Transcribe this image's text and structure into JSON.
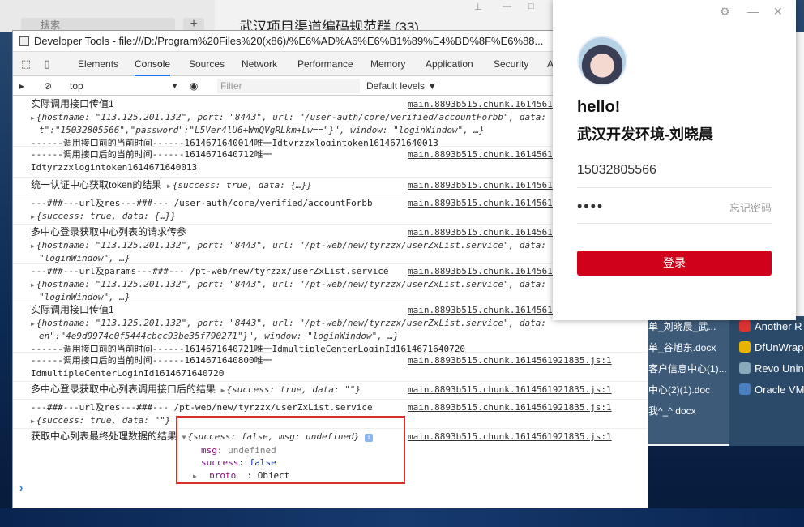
{
  "chat": {
    "search": "搜索",
    "title": "武汉项目渠道编码规范群 (33)"
  },
  "devtools": {
    "title": "Developer Tools - file:///D:/Program%20Files%20(x86)/%E6%AD%A6%E6%B1%89%E4%BD%8F%E6%88...",
    "tabs": [
      "Elements",
      "Console",
      "Sources",
      "Network",
      "Performance",
      "Memory",
      "Application",
      "Security",
      "A"
    ],
    "context": "top",
    "filter_placeholder": "Filter",
    "levels": "Default levels ▼",
    "source": "main.8893b515.chunk.1614561921835.js:1"
  },
  "console": [
    {
      "text": "实际调用接口传值1",
      "obj": "{hostname: \"113.125.201.132\", port: \"8443\", url: \"/user-auth/core/verified/accountForbb\", data:",
      "obj2": "t\":\"15032805566\",\"password\":\"L5Ver4lU6+WmQVgRLkm+Lw==\"}\", window: \"loginWindow\", …}",
      "line3": "------调用接口前的当前时间------1614671640014唯一Idtyrzzxlogintoken1614671640013"
    },
    {
      "text": "------调用接口后的当前时间------1614671640712唯一",
      "line2": "Idtyrzzxlogintoken1614671640013"
    },
    {
      "text": "统一认证中心获取token的结果",
      "obj": "{success: true, data: {…}}"
    },
    {
      "text": "---###---url及res---###--- /user-auth/core/verified/accountForbb",
      "obj": "{success: true, data: {…}}"
    },
    {
      "text": "多中心登录获取中心列表的请求传参",
      "obj": "{hostname: \"113.125.201.132\", port: \"8443\", url: \"/pt-web/new/tyrzzx/userZxList.service\", data:",
      "obj2": "\"loginWindow\", …}"
    },
    {
      "text": "---###---url及params---###--- /pt-web/new/tyrzzx/userZxList.service",
      "obj": "{hostname: \"113.125.201.132\", port: \"8443\", url: \"/pt-web/new/tyrzzx/userZxList.service\", data:",
      "obj2": "\"loginWindow\", …}"
    },
    {
      "text": "实际调用接口传值1",
      "obj": "{hostname: \"113.125.201.132\", port: \"8443\", url: \"/pt-web/new/tyrzzx/userZxList.service\", data:",
      "obj2": "en\":\"4e9d9974c0f5444cbcc93be35f790271\"}\", window: \"loginWindow\", …}",
      "line3": "------调用接口前的当前时间------1614671640721唯一IdmultipleCenterLoginId1614671640720"
    },
    {
      "text": "------调用接口后的当前时间------1614671640800唯一",
      "line2": "IdmultipleCenterLoginId1614671640720"
    },
    {
      "text": "多中心登录获取中心列表调用接口后的结果",
      "obj": "{success: true, data: \"\"}"
    },
    {
      "text": "---###---url及res---###--- /pt-web/new/tyrzzx/userZxList.service",
      "obj": "{success: true, data: \"\"}"
    },
    {
      "text": "获取中心列表最终处理数据的结果",
      "obj": "{success: false, msg: undefined}",
      "props": [
        {
          "k": "msg",
          "v": "undefined"
        },
        {
          "k": "success",
          "v": "false"
        },
        {
          "k": "__proto__",
          "v": "Object"
        }
      ]
    }
  ],
  "login": {
    "hello": "hello!",
    "env": "武汉开发环境-刘晓晨",
    "phone": "15032805566",
    "password": "••••",
    "forgot": "忘记密码",
    "submit": "登录"
  },
  "files": [
    "单_刘晓晨_武...",
    "单_谷旭东.docx",
    "客户信息中心(1)...",
    "中心(2)(1).doc",
    "我^_^.docx"
  ],
  "apps": [
    "Another R",
    "DfUnWrap",
    "Revo Unin",
    "Oracle VM"
  ]
}
